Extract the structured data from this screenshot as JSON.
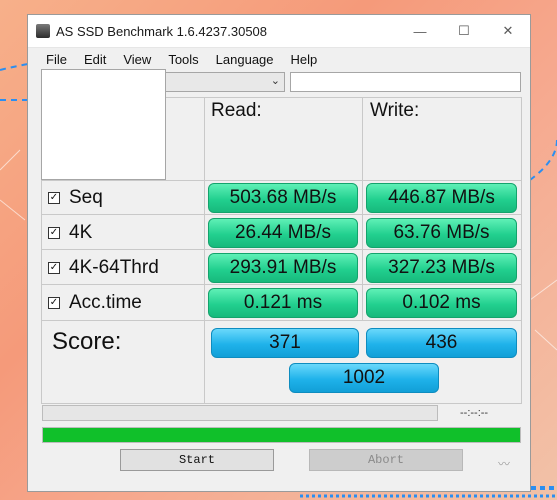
{
  "window": {
    "title": "AS SSD Benchmark 1.6.4237.30508",
    "controls": {
      "minimize": "—",
      "maximize": "☐",
      "close": "✕"
    }
  },
  "menu": [
    "File",
    "Edit",
    "View",
    "Tools",
    "Language",
    "Help"
  ],
  "toolbar": {
    "drive_select_value": "",
    "path_value": ""
  },
  "headers": {
    "read": "Read:",
    "write": "Write:"
  },
  "rows": [
    {
      "label": "Seq",
      "checked": true,
      "read": "503.68 MB/s",
      "write": "446.87 MB/s"
    },
    {
      "label": "4K",
      "checked": true,
      "read": "26.44 MB/s",
      "write": "63.76 MB/s"
    },
    {
      "label": "4K-64Thrd",
      "checked": true,
      "read": "293.91 MB/s",
      "write": "327.23 MB/s"
    },
    {
      "label": "Acc.time",
      "checked": true,
      "read": "0.121 ms",
      "write": "0.102 ms"
    }
  ],
  "score": {
    "label": "Score:",
    "read": "371",
    "write": "436",
    "total": "1002"
  },
  "status": {
    "time": "--:--:--",
    "small_progress": 0,
    "main_progress": 1.0
  },
  "buttons": {
    "start": "Start",
    "abort": "Abort"
  },
  "colors": {
    "value_bg": "#22d08f",
    "score_bg": "#1fb2ea",
    "progress": "#10c02a"
  }
}
